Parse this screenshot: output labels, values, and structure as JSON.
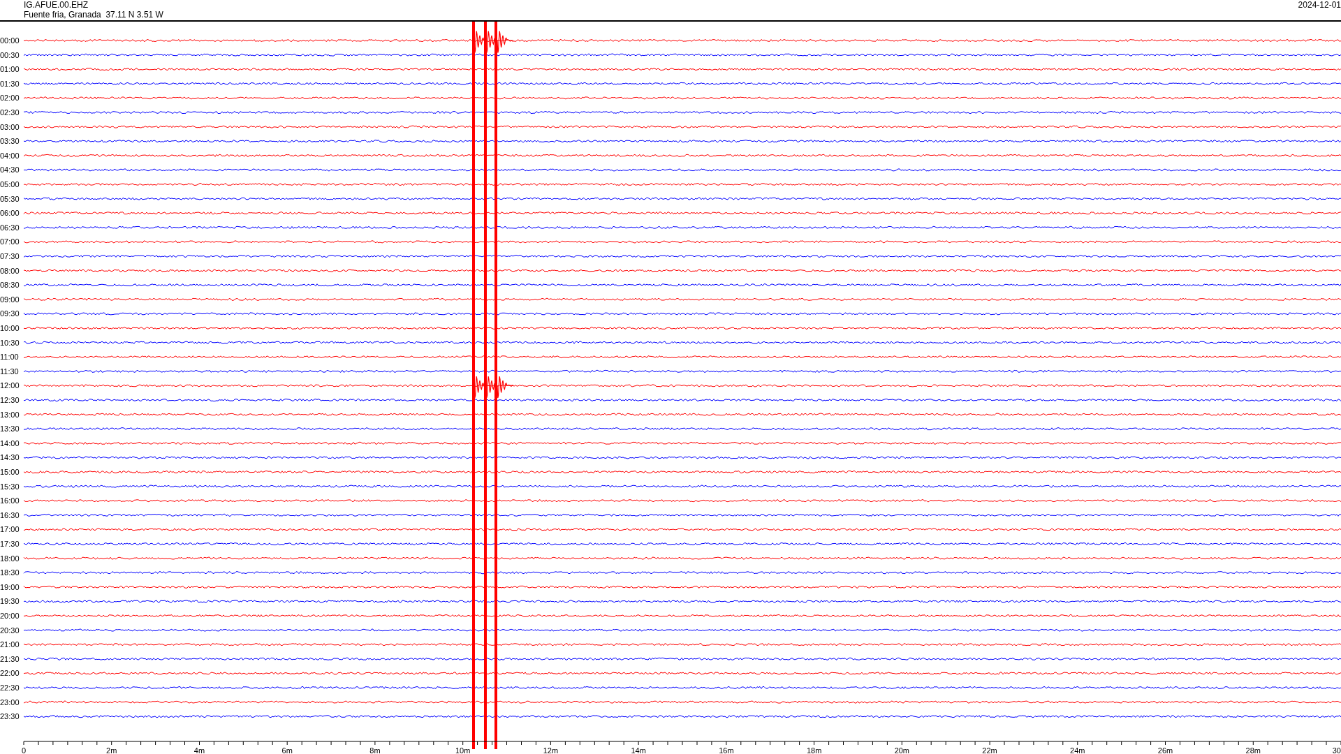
{
  "header": {
    "station": "IG.AFUE.00.EHZ",
    "location": "Fuente fria, Granada  37.11 N 3.51 W",
    "date": "2024-12-01"
  },
  "rows": [
    {
      "time": "00:00",
      "color": "#ff0000"
    },
    {
      "time": "00:30",
      "color": "#0000ff"
    },
    {
      "time": "01:00",
      "color": "#ff0000"
    },
    {
      "time": "01:30",
      "color": "#0000ff"
    },
    {
      "time": "02:00",
      "color": "#ff0000"
    },
    {
      "time": "02:30",
      "color": "#0000ff"
    },
    {
      "time": "03:00",
      "color": "#ff0000"
    },
    {
      "time": "03:30",
      "color": "#0000ff"
    },
    {
      "time": "04:00",
      "color": "#ff0000"
    },
    {
      "time": "04:30",
      "color": "#0000ff"
    },
    {
      "time": "05:00",
      "color": "#ff0000"
    },
    {
      "time": "05:30",
      "color": "#0000ff"
    },
    {
      "time": "06:00",
      "color": "#ff0000"
    },
    {
      "time": "06:30",
      "color": "#0000ff"
    },
    {
      "time": "07:00",
      "color": "#ff0000"
    },
    {
      "time": "07:30",
      "color": "#0000ff"
    },
    {
      "time": "08:00",
      "color": "#ff0000"
    },
    {
      "time": "08:30",
      "color": "#0000ff"
    },
    {
      "time": "09:00",
      "color": "#ff0000"
    },
    {
      "time": "09:30",
      "color": "#0000ff"
    },
    {
      "time": "10:00",
      "color": "#ff0000"
    },
    {
      "time": "10:30",
      "color": "#0000ff"
    },
    {
      "time": "11:00",
      "color": "#ff0000"
    },
    {
      "time": "11:30",
      "color": "#0000ff"
    },
    {
      "time": "12:00",
      "color": "#ff0000"
    },
    {
      "time": "12:30",
      "color": "#0000ff"
    },
    {
      "time": "13:00",
      "color": "#ff0000"
    },
    {
      "time": "13:30",
      "color": "#0000ff"
    },
    {
      "time": "14:00",
      "color": "#ff0000"
    },
    {
      "time": "14:30",
      "color": "#0000ff"
    },
    {
      "time": "15:00",
      "color": "#ff0000"
    },
    {
      "time": "15:30",
      "color": "#0000ff"
    },
    {
      "time": "16:00",
      "color": "#ff0000"
    },
    {
      "time": "16:30",
      "color": "#0000ff"
    },
    {
      "time": "17:00",
      "color": "#ff0000"
    },
    {
      "time": "17:30",
      "color": "#0000ff"
    },
    {
      "time": "18:00",
      "color": "#ff0000"
    },
    {
      "time": "18:30",
      "color": "#0000ff"
    },
    {
      "time": "19:00",
      "color": "#ff0000"
    },
    {
      "time": "19:30",
      "color": "#0000ff"
    },
    {
      "time": "20:00",
      "color": "#ff0000"
    },
    {
      "time": "20:30",
      "color": "#0000ff"
    },
    {
      "time": "21:00",
      "color": "#ff0000"
    },
    {
      "time": "21:30",
      "color": "#0000ff"
    },
    {
      "time": "22:00",
      "color": "#ff0000"
    },
    {
      "time": "22:30",
      "color": "#0000ff"
    },
    {
      "time": "23:00",
      "color": "#ff0000"
    },
    {
      "time": "23:30",
      "color": "#0000ff"
    }
  ],
  "x_axis": {
    "labels": [
      "0",
      "2m",
      "4m",
      "6m",
      "8m",
      "10m",
      "12m",
      "14m",
      "16m",
      "18m",
      "20m",
      "22m",
      "24m",
      "26m",
      "28m",
      "30"
    ]
  }
}
